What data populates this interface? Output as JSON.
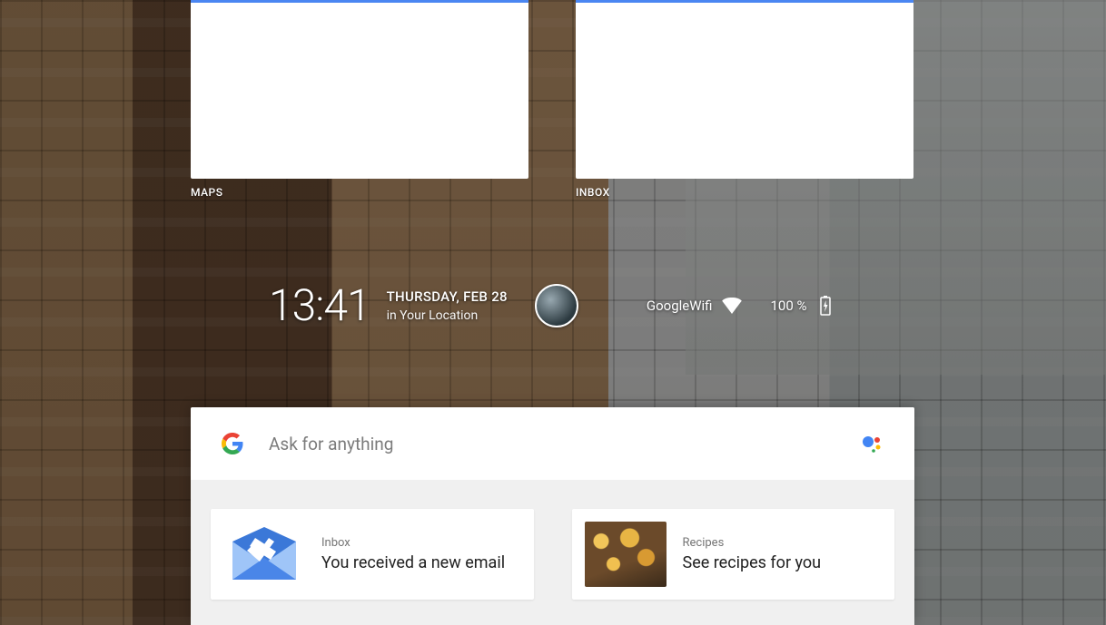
{
  "widgets": [
    {
      "label": "MAPS"
    },
    {
      "label": "INBOX"
    }
  ],
  "clock": {
    "time": "13:41",
    "date": "THURSDAY, FEB 28",
    "location": "in Your Location"
  },
  "status": {
    "wifi_name": "GoogleWifi",
    "battery": "100 %"
  },
  "search": {
    "placeholder": "Ask for anything"
  },
  "feed": [
    {
      "label": "Inbox",
      "body": "You received a new email"
    },
    {
      "label": "Recipes",
      "body": "See recipes for you"
    }
  ]
}
